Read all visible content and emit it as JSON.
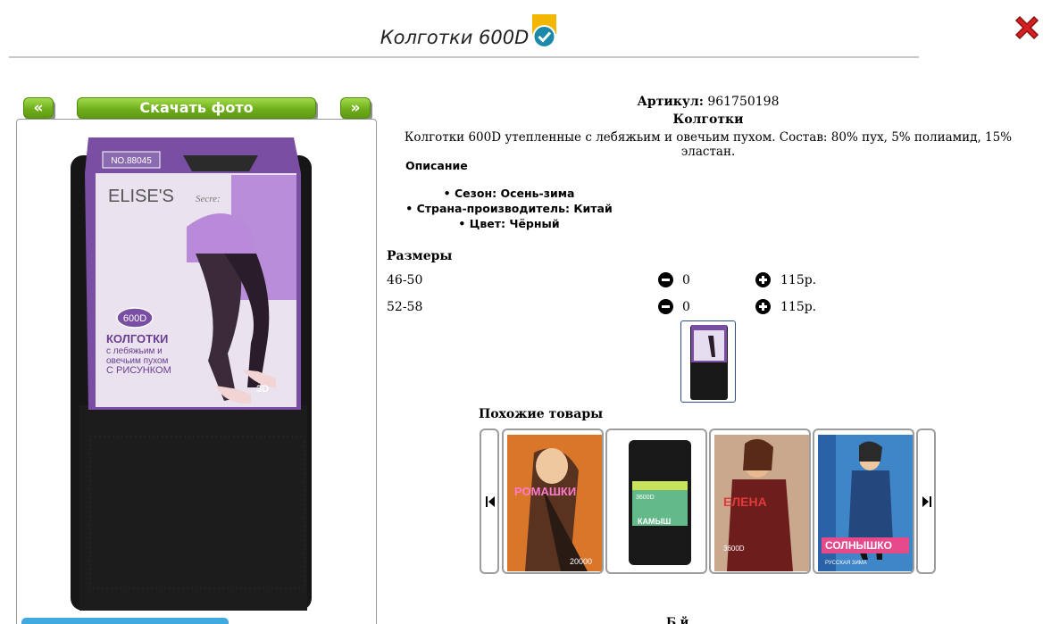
{
  "product": {
    "title": "Колготки 600D",
    "article_label": "Артикул:",
    "article_value": "961750198",
    "category": "Колготки",
    "description": "Колготки 600D утепленные с лебяжьим и овечьим пухом. Состав: 80% пух, 5% полиамид, 15% эластан."
  },
  "photo_nav": {
    "prev_label": "«",
    "download_label": "Скачать фото",
    "next_label": "»"
  },
  "package": {
    "code": "NO.88045",
    "brand": "ELISE'S",
    "brand_suffix": "Secre:",
    "badge": "600D",
    "name_line1": "КОЛГОТКИ",
    "name_line2": "с лебяжьим  и",
    "name_line3": "овечьим  пухом",
    "name_line4": "С РИСУНКОМ",
    "mark": "3D"
  },
  "details": {
    "heading": "Описание",
    "features": [
      "Сезон: Осень-зима",
      "Страна-производитель: Китай",
      "Цвет: Чёрный"
    ]
  },
  "sizes": {
    "heading": "Размеры",
    "rows": [
      {
        "size": "46-50",
        "qty": "0",
        "price": "115р."
      },
      {
        "size": "52-58",
        "qty": "0",
        "price": "115р."
      }
    ]
  },
  "similar": {
    "heading": "Похожие товары",
    "items": [
      {
        "label": "РОМАШКИ",
        "sub": "20000"
      },
      {
        "label": "КАМЫШ",
        "sub": "3600D"
      },
      {
        "label": "ЕЛЕНА",
        "sub": "3600D"
      },
      {
        "label": "СОЛНЫШКО",
        "sub": "РУССКАЯ ЗИМА"
      }
    ]
  },
  "bottom_partial": "Б й",
  "colors": {
    "accent_green": "#6fae1d",
    "close_red": "#d42020",
    "check_badge": "#f2b705",
    "check_circle": "#1a8aa8"
  },
  "icons": [
    "check-badge-icon",
    "close-icon",
    "minus-icon",
    "plus-icon",
    "first-icon",
    "last-icon"
  ]
}
